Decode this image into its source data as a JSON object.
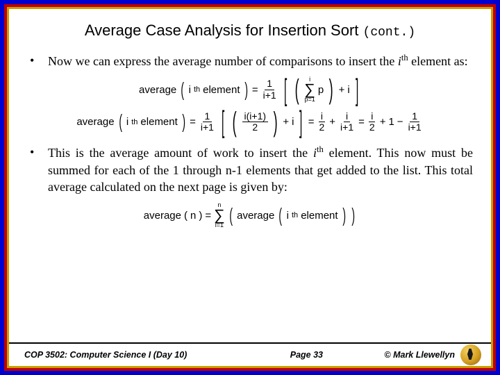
{
  "title_main": "Average Case Analysis for Insertion Sort",
  "title_cont": "(cont.)",
  "bullet1_pre": "Now we can express the average number of comparisons to insert the ",
  "bullet1_i": "i",
  "bullet1_th": "th",
  "bullet1_post": " element as:",
  "bullet2_a": "This is the average amount of work to insert the ",
  "bullet2_i": "i",
  "bullet2_th": "th",
  "bullet2_b": " element. This now must be summed for each of the 1 through n-1 elements that get added to the list.   This total average calculated on the next page is given by:",
  "f_avg": "average",
  "f_ith": "i",
  "f_th": "th",
  "f_element": " element",
  "f_eq": "=",
  "f_plus": "+",
  "f_minus": "−",
  "f_one": "1",
  "f_two": "2",
  "f_ip1": "i+1",
  "f_i": "i",
  "f_p1": "p=1",
  "f_p": "p",
  "f_iip1": "i(i+1)",
  "f_n": "n",
  "f_i1": "i=1",
  "footer_left": "COP 3502: Computer Science I  (Day 10)",
  "footer_center": "Page 33",
  "footer_right": "© Mark Llewellyn"
}
